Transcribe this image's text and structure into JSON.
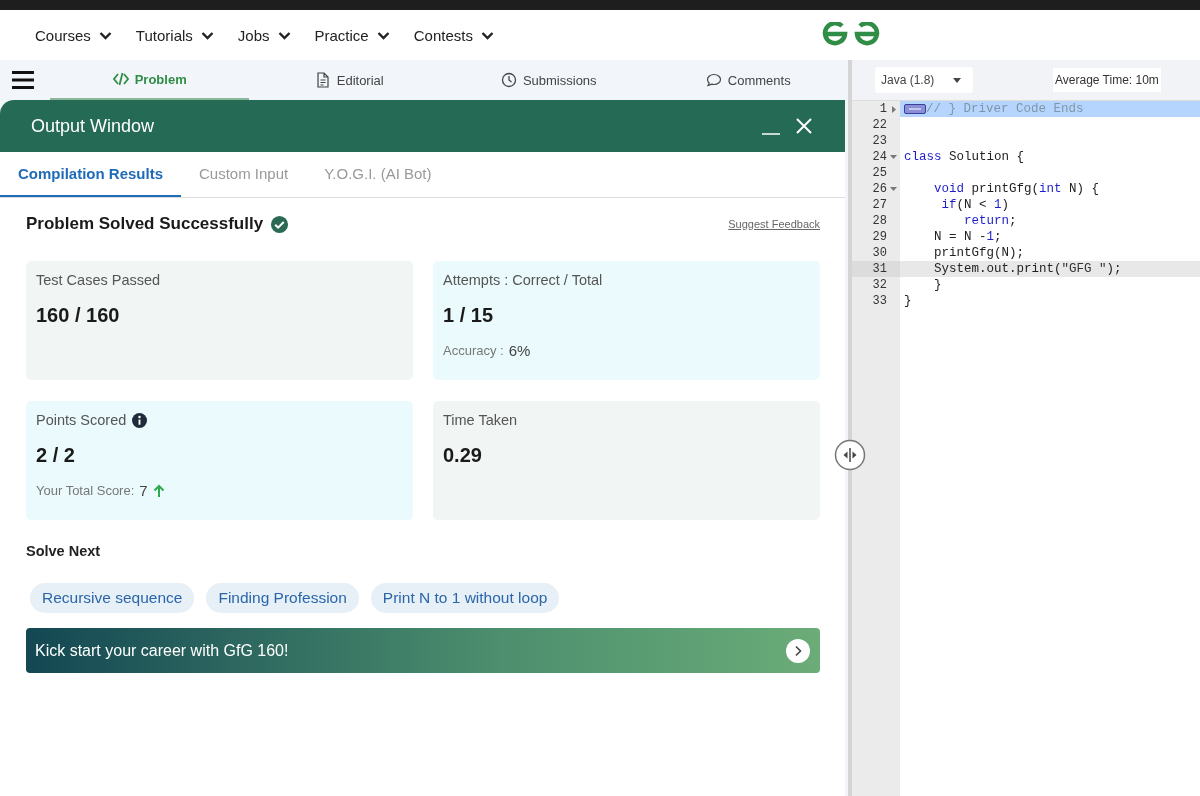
{
  "nav": {
    "items": [
      {
        "label": "Courses"
      },
      {
        "label": "Tutorials"
      },
      {
        "label": "Jobs"
      },
      {
        "label": "Practice"
      },
      {
        "label": "Contests"
      }
    ]
  },
  "problem_tabs": [
    {
      "label": "Problem",
      "kind": "code",
      "selected": true
    },
    {
      "label": "Editorial",
      "kind": "document",
      "selected": false
    },
    {
      "label": "Submissions",
      "kind": "clock",
      "selected": false
    },
    {
      "label": "Comments",
      "kind": "chat",
      "selected": false
    }
  ],
  "output_window": {
    "title": "Output Window",
    "tabs": [
      {
        "label": "Compilation Results",
        "selected": true
      },
      {
        "label": "Custom Input",
        "selected": false
      },
      {
        "label": "Y.O.G.I. (AI Bot)",
        "selected": false
      }
    ],
    "status": "Problem Solved Successfully",
    "feedback_link": "Suggest Feedback",
    "cards": [
      {
        "label": "Test Cases Passed",
        "value": "160 / 160",
        "info": false,
        "color": "#f1f5f4"
      },
      {
        "label": "Attempts : Correct / Total",
        "value": "1 / 15",
        "info": false,
        "color": "#ebfbfd",
        "note_label": "Accuracy :",
        "note_value": "6%",
        "rising": false
      },
      {
        "label": "Points Scored",
        "value": "2 / 2",
        "info": true,
        "color": "#ebfbfd",
        "note_label": "Your Total Score:",
        "note_value": "7",
        "rising": true
      },
      {
        "label": "Time Taken",
        "value": "0.29",
        "info": false,
        "color": "#f1f5f4"
      }
    ],
    "solve_next": {
      "title": "Solve Next",
      "items": [
        "Recursive sequence",
        "Finding Profession",
        "Print N to 1 without loop"
      ]
    },
    "banner": {
      "text": "Kick start your career with GfG 160!"
    }
  },
  "editor": {
    "language": "Java (1.8)",
    "average_time": "Average Time: 10m",
    "lines": [
      {
        "number": "1",
        "foldable": true,
        "expanded": false,
        "selected": true,
        "active": false,
        "tokens": [
          {
            "text": "// } Driver Code Ends",
            "kind": "comment"
          }
        ]
      },
      {
        "number": "22",
        "foldable": false,
        "selected": false,
        "active": false
      },
      {
        "number": "23",
        "foldable": false,
        "selected": false,
        "active": false
      },
      {
        "number": "24",
        "foldable": true,
        "expanded": true,
        "selected": false,
        "active": false,
        "tokens": [
          {
            "text": "class",
            "kind": "keyword"
          },
          {
            "text": " Solution {",
            "kind": "plain"
          }
        ]
      },
      {
        "number": "25",
        "foldable": false,
        "selected": false,
        "active": false
      },
      {
        "number": "26",
        "foldable": true,
        "expanded": true,
        "selected": false,
        "active": false,
        "tokens": [
          {
            "text": "    void",
            "kind": "keyword"
          },
          {
            "text": " printGfg(",
            "kind": "plain"
          },
          {
            "text": "int",
            "kind": "keyword"
          },
          {
            "text": " N) {",
            "kind": "plain"
          }
        ]
      },
      {
        "number": "27",
        "foldable": false,
        "selected": false,
        "active": false,
        "tokens": [
          {
            "text": "     if",
            "kind": "keyword"
          },
          {
            "text": "(N < ",
            "kind": "plain"
          },
          {
            "text": "1",
            "kind": "number"
          },
          {
            "text": ")",
            "kind": "plain"
          }
        ]
      },
      {
        "number": "28",
        "foldable": false,
        "selected": false,
        "active": false,
        "tokens": [
          {
            "text": "        return",
            "kind": "keyword"
          },
          {
            "text": ";",
            "kind": "plain"
          }
        ]
      },
      {
        "number": "29",
        "foldable": false,
        "selected": false,
        "active": false,
        "tokens": [
          {
            "text": "    N = N -",
            "kind": "plain"
          },
          {
            "text": "1",
            "kind": "number"
          },
          {
            "text": ";",
            "kind": "plain"
          }
        ]
      },
      {
        "number": "30",
        "foldable": false,
        "selected": false,
        "active": false,
        "tokens": [
          {
            "text": "    printGfg(N);",
            "kind": "plain"
          }
        ]
      },
      {
        "number": "31",
        "foldable": false,
        "selected": false,
        "active": true,
        "tokens": [
          {
            "text": "    System.out.print(",
            "kind": "plain"
          },
          {
            "text": "\"GFG \"",
            "kind": "string"
          },
          {
            "text": ");",
            "kind": "plain"
          }
        ]
      },
      {
        "number": "32",
        "foldable": false,
        "selected": false,
        "active": false,
        "tokens": [
          {
            "text": "    }",
            "kind": "plain"
          }
        ]
      },
      {
        "number": "33",
        "foldable": false,
        "selected": false,
        "active": false,
        "tokens": [
          {
            "text": "}",
            "kind": "plain"
          }
        ]
      }
    ]
  }
}
